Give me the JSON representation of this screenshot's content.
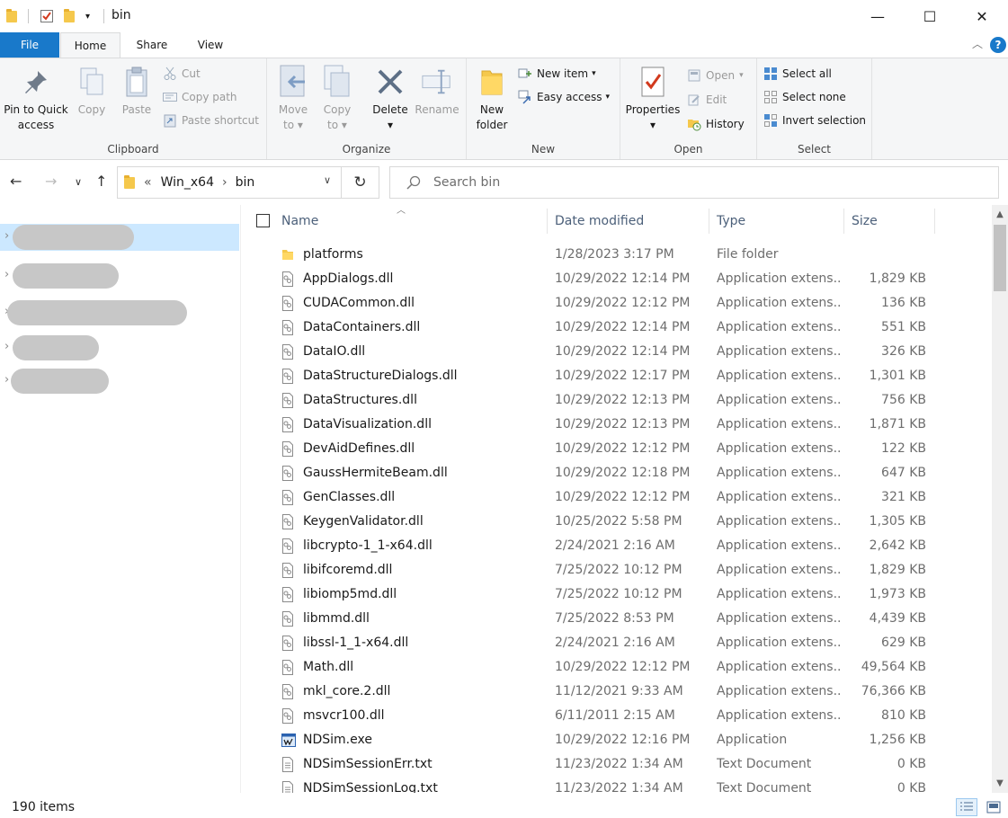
{
  "window": {
    "title": "bin",
    "minimize": "—",
    "maximize": "☐",
    "close": "✕"
  },
  "ribbon_tabs": [
    {
      "label": "File"
    },
    {
      "label": "Home"
    },
    {
      "label": "Share"
    },
    {
      "label": "View"
    }
  ],
  "ribbon": {
    "clipboard": {
      "label": "Clipboard",
      "pin": "Pin to Quick access",
      "pin_line1": "Pin to Quick",
      "pin_line2": "access",
      "copy": "Copy",
      "paste": "Paste",
      "cut": "Cut",
      "copy_path": "Copy path",
      "paste_shortcut": "Paste shortcut"
    },
    "organize": {
      "label": "Organize",
      "move_to_line1": "Move",
      "move_to_line2": "to",
      "copy_to_line1": "Copy",
      "copy_to_line2": "to",
      "delete": "Delete",
      "rename": "Rename"
    },
    "new": {
      "label": "New",
      "new_folder_line1": "New",
      "new_folder_line2": "folder",
      "new_item": "New item",
      "easy_access": "Easy access"
    },
    "open": {
      "label": "Open",
      "properties": "Properties",
      "open": "Open",
      "edit": "Edit",
      "history": "History"
    },
    "select": {
      "label": "Select",
      "select_all": "Select all",
      "select_none": "Select none",
      "invert_selection": "Invert selection"
    }
  },
  "address": {
    "overflow": "«",
    "crumbs": [
      "Win_x64",
      "bin"
    ],
    "separator": "›"
  },
  "search": {
    "placeholder": "Search bin"
  },
  "columns": {
    "name": "Name",
    "date": "Date modified",
    "type": "Type",
    "size": "Size"
  },
  "files": [
    {
      "name": "platforms",
      "date": "1/28/2023 3:17 PM",
      "type": "File folder",
      "size": "",
      "kind": "folder"
    },
    {
      "name": "AppDialogs.dll",
      "date": "10/29/2022 12:14 PM",
      "type": "Application extens...",
      "size": "1,829 KB",
      "kind": "dll"
    },
    {
      "name": "CUDACommon.dll",
      "date": "10/29/2022 12:12 PM",
      "type": "Application extens...",
      "size": "136 KB",
      "kind": "dll"
    },
    {
      "name": "DataContainers.dll",
      "date": "10/29/2022 12:14 PM",
      "type": "Application extens...",
      "size": "551 KB",
      "kind": "dll"
    },
    {
      "name": "DataIO.dll",
      "date": "10/29/2022 12:14 PM",
      "type": "Application extens...",
      "size": "326 KB",
      "kind": "dll"
    },
    {
      "name": "DataStructureDialogs.dll",
      "date": "10/29/2022 12:17 PM",
      "type": "Application extens...",
      "size": "1,301 KB",
      "kind": "dll"
    },
    {
      "name": "DataStructures.dll",
      "date": "10/29/2022 12:13 PM",
      "type": "Application extens...",
      "size": "756 KB",
      "kind": "dll"
    },
    {
      "name": "DataVisualization.dll",
      "date": "10/29/2022 12:13 PM",
      "type": "Application extens...",
      "size": "1,871 KB",
      "kind": "dll"
    },
    {
      "name": "DevAidDefines.dll",
      "date": "10/29/2022 12:12 PM",
      "type": "Application extens...",
      "size": "122 KB",
      "kind": "dll"
    },
    {
      "name": "GaussHermiteBeam.dll",
      "date": "10/29/2022 12:18 PM",
      "type": "Application extens...",
      "size": "647 KB",
      "kind": "dll"
    },
    {
      "name": "GenClasses.dll",
      "date": "10/29/2022 12:12 PM",
      "type": "Application extens...",
      "size": "321 KB",
      "kind": "dll"
    },
    {
      "name": "KeygenValidator.dll",
      "date": "10/25/2022 5:58 PM",
      "type": "Application extens...",
      "size": "1,305 KB",
      "kind": "dll"
    },
    {
      "name": "libcrypto-1_1-x64.dll",
      "date": "2/24/2021 2:16 AM",
      "type": "Application extens...",
      "size": "2,642 KB",
      "kind": "dll"
    },
    {
      "name": "libifcoremd.dll",
      "date": "7/25/2022 10:12 PM",
      "type": "Application extens...",
      "size": "1,829 KB",
      "kind": "dll"
    },
    {
      "name": "libiomp5md.dll",
      "date": "7/25/2022 10:12 PM",
      "type": "Application extens...",
      "size": "1,973 KB",
      "kind": "dll"
    },
    {
      "name": "libmmd.dll",
      "date": "7/25/2022 8:53 PM",
      "type": "Application extens...",
      "size": "4,439 KB",
      "kind": "dll"
    },
    {
      "name": "libssl-1_1-x64.dll",
      "date": "2/24/2021 2:16 AM",
      "type": "Application extens...",
      "size": "629 KB",
      "kind": "dll"
    },
    {
      "name": "Math.dll",
      "date": "10/29/2022 12:12 PM",
      "type": "Application extens...",
      "size": "49,564 KB",
      "kind": "dll"
    },
    {
      "name": "mkl_core.2.dll",
      "date": "11/12/2021 9:33 AM",
      "type": "Application extens...",
      "size": "76,366 KB",
      "kind": "dll"
    },
    {
      "name": "msvcr100.dll",
      "date": "6/11/2011 2:15 AM",
      "type": "Application extens...",
      "size": "810 KB",
      "kind": "dll"
    },
    {
      "name": "NDSim.exe",
      "date": "10/29/2022 12:16 PM",
      "type": "Application",
      "size": "1,256 KB",
      "kind": "exe"
    },
    {
      "name": "NDSimSessionErr.txt",
      "date": "11/23/2022 1:34 AM",
      "type": "Text Document",
      "size": "0 KB",
      "kind": "txt"
    },
    {
      "name": "NDSimSessionLog.txt",
      "date": "11/23/2022 1:34 AM",
      "type": "Text Document",
      "size": "0 KB",
      "kind": "txt"
    }
  ],
  "status": {
    "items": "190 items"
  },
  "colors": {
    "accent": "#1979ca",
    "selection": "#cce8ff",
    "folder": "#f5c84c"
  }
}
